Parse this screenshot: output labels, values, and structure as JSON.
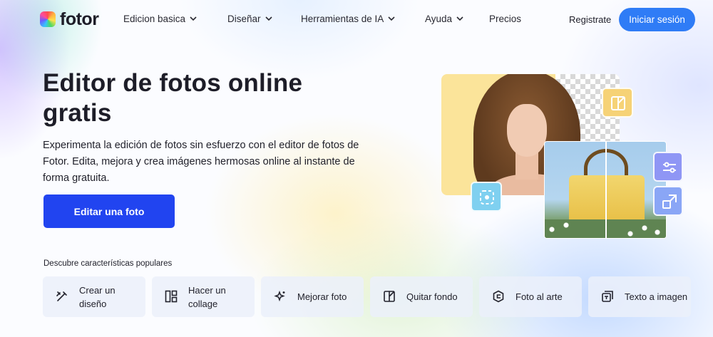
{
  "brand": {
    "logo_text": "fotor"
  },
  "nav": {
    "items": [
      {
        "label": "Edicion basica",
        "has_dropdown": true
      },
      {
        "label": "Diseñar",
        "has_dropdown": true
      },
      {
        "label": "Herramientas de IA",
        "has_dropdown": true
      },
      {
        "label": "Ayuda",
        "has_dropdown": true
      },
      {
        "label": "Precios",
        "has_dropdown": false
      }
    ],
    "register_label": "Registrate",
    "login_label": "Iniciar sesión"
  },
  "hero": {
    "title": "Editor de fotos online gratis",
    "description": "Experimenta la edición de fotos sin esfuerzo con el editor de fotos de Fotor. Edita, mejora y crea imágenes hermosas online al instante de forma gratuita.",
    "cta_label": "Editar una foto"
  },
  "features": {
    "heading": "Descubre características populares",
    "items": [
      {
        "label": "Crear un diseño",
        "icon": "design-tool-icon"
      },
      {
        "label": "Hacer un collage",
        "icon": "collage-icon"
      },
      {
        "label": "Mejorar foto",
        "icon": "enhance-sparkle-icon"
      },
      {
        "label": "Quitar fondo",
        "icon": "remove-background-icon"
      },
      {
        "label": "Foto al arte",
        "icon": "photo-to-art-icon"
      },
      {
        "label": "Texto a imagen",
        "icon": "text-to-image-icon"
      }
    ]
  },
  "colors": {
    "primary_cta": "#2144f0",
    "login_button": "#2f7cf6",
    "text_dark": "#1d1d28",
    "feature_card_bg": "#ebf0fa"
  }
}
